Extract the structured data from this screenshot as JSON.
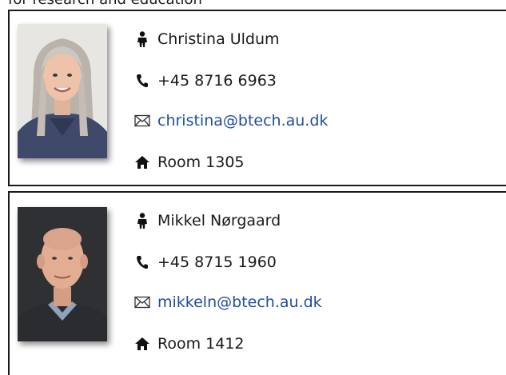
{
  "header": {
    "partial_text": "for research and education"
  },
  "contacts": [
    {
      "name": "Christina Uldum",
      "phone": "+45 8716 6963",
      "email": "christina@btech.au.dk",
      "room": "Room 1305"
    },
    {
      "name": "Mikkel Nørgaard",
      "phone": "+45 8715 1960",
      "email": "mikkeln@btech.au.dk",
      "room": "Room 1412"
    }
  ],
  "colors": {
    "link": "#1f4e9c",
    "border": "#1a1a1a"
  },
  "icons": {
    "person": "person-icon",
    "phone": "phone-icon",
    "email": "envelope-icon",
    "room": "house-icon"
  }
}
